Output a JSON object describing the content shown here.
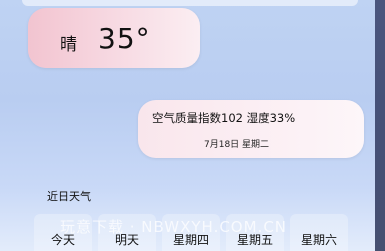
{
  "current": {
    "weather": "晴",
    "temperature": "35°"
  },
  "air": {
    "summary": "空气质量指数102 湿度33%",
    "date": "7月18日 星期二"
  },
  "forecast": {
    "title": "近日天气",
    "days": [
      {
        "label": "今天"
      },
      {
        "label": "明天"
      },
      {
        "label": "星期四"
      },
      {
        "label": "星期五"
      },
      {
        "label": "星期六"
      }
    ]
  },
  "watermark": "玩意下载 · NBWXYH.COM.CN"
}
